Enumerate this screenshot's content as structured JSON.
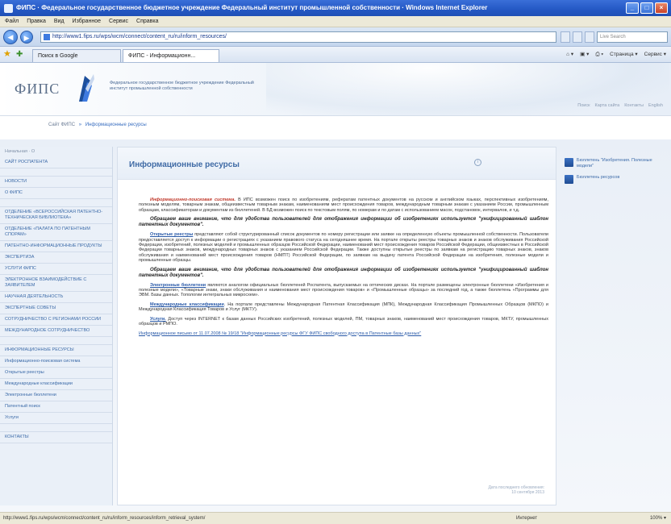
{
  "window": {
    "title": "ФИПС · Федеральное государственное бюджетное учреждение Федеральный институт промышленной собственности · Windows Internet Explorer",
    "minimize": "_",
    "maximize": "□",
    "close": "×"
  },
  "menu": [
    "Файл",
    "Правка",
    "Вид",
    "Избранное",
    "Сервис",
    "Справка"
  ],
  "address": {
    "back": "◀",
    "forward": "▶",
    "url": "http://www1.fips.ru/wps/wcm/connect/content_ru/ru/inform_resources/",
    "search_placeholder": "Live Search"
  },
  "tabs": [
    {
      "label": "Поиск в Google"
    },
    {
      "label": "ФИПС - Информационн..."
    }
  ],
  "command_bar": [
    "Страница ▾",
    "Сервис ▾"
  ],
  "site": {
    "logo": "ФИПС",
    "institute_name": "Федеральное государственное бюджетное учреждение Федеральный институт промышленной собственности",
    "header_links": [
      "Поиск",
      "Карта сайта",
      "Контакты",
      "English"
    ]
  },
  "breadcrumb": {
    "home": "Сайт ФИПС",
    "separator": "»",
    "current": "Информационные ресурсы"
  },
  "left_nav": {
    "header": "Начальная · О",
    "items": [
      {
        "label": "Сайт Роспатента",
        "plain": false
      },
      {
        "label": "Новости",
        "plain": false
      },
      {
        "label": "О ФИПС",
        "plain": false
      },
      {
        "label": "Отделение «Всероссийская патентно-техническая библиотека»",
        "plain": false
      },
      {
        "label": "Отделение «Палата по патентным спорам»",
        "plain": false
      },
      {
        "label": "Патентно-информационные продукты",
        "plain": false
      },
      {
        "label": "Экспертиза",
        "plain": false
      },
      {
        "label": "Услуги ФИПС",
        "plain": false
      },
      {
        "label": "Электронное взаимодействие с заявителем",
        "plain": false
      },
      {
        "label": "Научная деятельность",
        "plain": false
      },
      {
        "label": "Экспертные советы",
        "plain": false
      },
      {
        "label": "Сотрудничество с регионами России",
        "plain": false
      },
      {
        "label": "Международное сотрудничество",
        "plain": false
      },
      {
        "label": "Информационные ресурсы",
        "plain": false
      },
      {
        "label": "Информационно-поисковая система",
        "plain": true
      },
      {
        "label": "Открытые реестры",
        "plain": true
      },
      {
        "label": "Международные классификации",
        "plain": true
      },
      {
        "label": "Электронные бюллетени",
        "plain": true
      },
      {
        "label": "Патентный поиск",
        "plain": true
      },
      {
        "label": "Услуги",
        "plain": true
      },
      {
        "label": "Контакты",
        "plain": false
      }
    ]
  },
  "content": {
    "title": "Информационные ресурсы",
    "print_icon": "i",
    "p1_lead": "Информационно-поисковая система.",
    "p1_body": " В ИПС возможен поиск по изобретениям, рефератам патентных документов на русском и английском языках, перспективных изобретениям, полезным моделям, товарным знакам, общеизвестным товарным знакам, наименованиям мест происхождения товаров, международным товарным знакам с указанием России, промышленным образцам, классификаторам и документам из бюллетеней. В БД возможен поиск по текстовым полям, по номерам и по датам с использованием масок, подстановок, интервалов, и т.д.",
    "notice": "Обращаем ваше внимание, что для удобства пользователей для отображения информации об изобретениях используется \"унифицированный шаблон патентных документов\".",
    "p2_lead": "Открытые реестры",
    "p2_body": " представляют собой структурированный список документов по номеру регистрации или заявке на определенную объекты промышленной собственности. Пользователи предоставляется доступ к информации о регистрациях с указанием правового статуса на сегодняшнее время. На портале открыты реестры товарных знаков и знаков обслуживания Российской Федерации, изобретений, полезных моделей и промышленных образцов Российской Федерации, наименований мест происхождения товаров Российской Федерации, общеизвестных в Российской Федерации товарных знаков, международных товарных знаков с указанием Российской Федерации. Также доступны открытые реестры по заявкам на регистрацию товарных знаков, знаков обслуживания и наименований мест происхождения товаров (НМПТ) Российской Федерации, по заявкам на выдачу патента Российской Федерации на изобретения, полезные модели и промышленные образцы.",
    "notice2": "Обращаем ваше внимание, что для удобства пользователей для отображения информации об изобретениях используется \"унифицированный шаблон патентных документов\".",
    "p3_lead": "Электронные бюллетени",
    "p3_body": " являются аналогом официальных бюллетеней Роспатента, выпускаемых на оптических дисках. На портале размещены электронные бюллетени «Изобретения и полезные модели», «Товарные знаки, знаки обслуживания и наименования мест происхождения товаров» и «Промышленные образцы» за последний год, а также бюллетень «Программы для ЭВМ. Базы данных. Топологии интегральных микросхем».",
    "p4_lead": "Международные классификации",
    "p4_body": ". На портале представлены Международная Патентная Классификация (МПК), Международная Классификация Промышленных Образцов (МКПО) и Международная Классификация Товаров и Услуг (МКТУ).",
    "p5_lead": "Услуги.",
    "p5_body": " Доступ через INTERNET к базам данных Российских изобретений, полезных моделей, ПМ, товарных знаков, наименований мест происхождения товаров, МКТУ, промышленных образцов и РМПО.",
    "footlink": "Информационное письмо от 11.07.2008 № 19/18 \"Информационные ресурсы ФГУ ФИПС свободного доступа в Патентные базы данных\"",
    "updated_label": "Дата последнего обновления:",
    "updated_date": "10 сентября 2013"
  },
  "right_links": [
    {
      "label": "Бюллетень \"Изобретения. Полезные модели\""
    },
    {
      "label": "Бюллетень ресурсов"
    }
  ],
  "status": {
    "text": "http://www1.fips.ru/wps/wcm/connect/content_ru/ru/inform_resources/inform_retrieval_system/",
    "zone": "Интернет",
    "zoom": "100% ▾"
  }
}
